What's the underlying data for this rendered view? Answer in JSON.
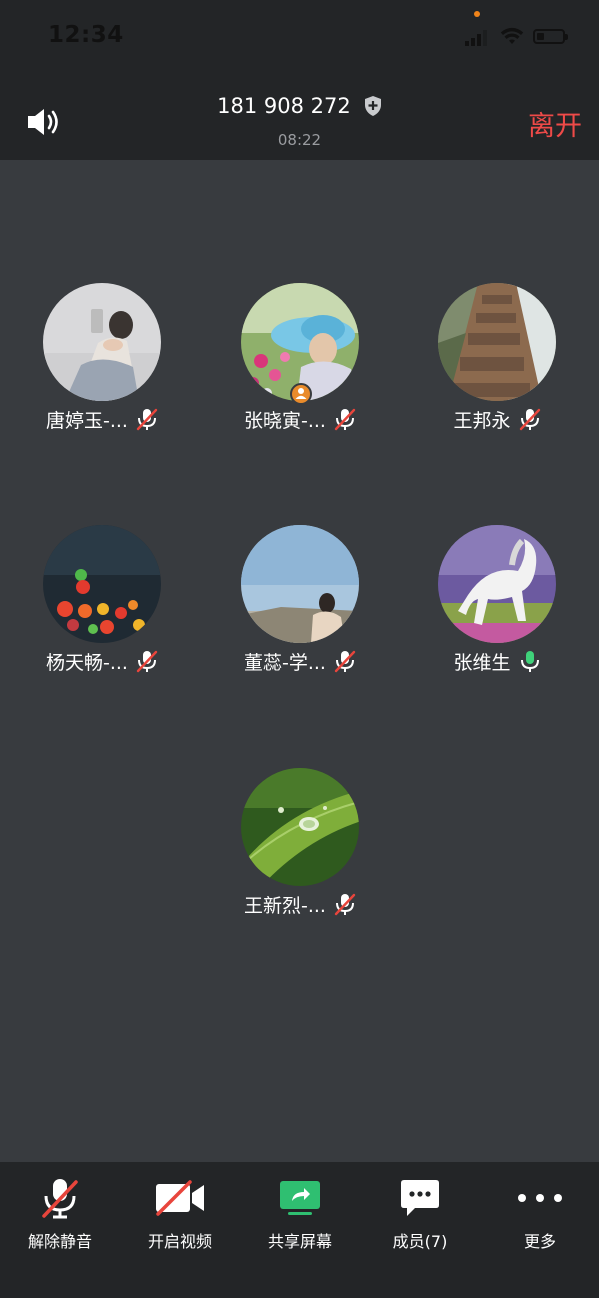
{
  "status_bar": {
    "time": "12:34"
  },
  "header": {
    "meeting_id": "181 908 272",
    "duration": "08:22",
    "leave_label": "离开"
  },
  "participants": [
    {
      "name": "唐婷玉-...",
      "mic": "muted"
    },
    {
      "name": "张晓寅-...",
      "mic": "muted",
      "host": true
    },
    {
      "name": "王邦永",
      "mic": "muted"
    },
    {
      "name": "杨天畅-...",
      "mic": "muted"
    },
    {
      "name": "董蕊-学...",
      "mic": "muted"
    },
    {
      "name": "张维生",
      "mic": "on"
    },
    {
      "name": "王新烈-...",
      "mic": "muted"
    }
  ],
  "toolbar": {
    "unmute_label": "解除静音",
    "start_video_label": "开启视频",
    "share_screen_label": "共享屏幕",
    "members_label": "成员(7)",
    "more_label": "更多"
  },
  "colors": {
    "leave": "#ef4a48",
    "share": "#2fbf71",
    "mic_on": "#3fd27a",
    "mute_slash": "#e8453c"
  }
}
